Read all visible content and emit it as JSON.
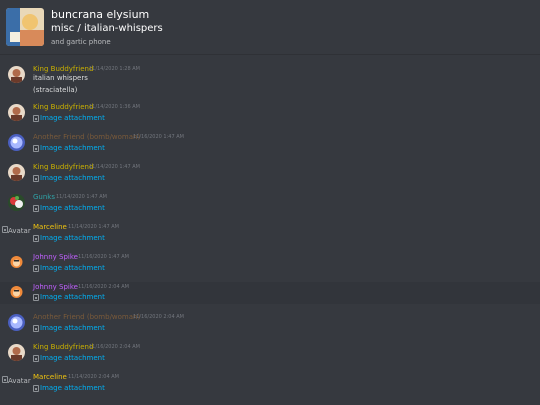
{
  "header": {
    "server_name": "buncrana elysium",
    "channel_name": "misc / italian-whispers",
    "topic": "and gartic phone"
  },
  "colors": {
    "king": "#c9b000",
    "another": "#7a5a3a",
    "gunks": "#2fa4a8",
    "marceline": "#f1c40f",
    "johnny": "#c160ff",
    "link": "#00b0f4"
  },
  "messages": [
    {
      "author": "King Buddyfriend",
      "time": "11/14/2020 1:28 AM",
      "lines": [
        "italian whispers",
        "(straciatella)"
      ]
    },
    {
      "author": "King Buddyfriend",
      "time": "11/14/2020 1:36 AM",
      "attachment": "Image attachment"
    },
    {
      "author": "Another Friend (bomb/woman)",
      "time": "11/16/2020 1:47 AM",
      "attachment": "Image attachment"
    },
    {
      "author": "King Buddyfriend",
      "time": "11/14/2020 1:47 AM",
      "attachment": "Image attachment"
    },
    {
      "author": "Gunks",
      "time": "11/14/2020 1:47 AM",
      "attachment": "Image attachment"
    },
    {
      "author": "Marceline",
      "time": "11/14/2020 1:47 AM",
      "attachment": "Image attachment",
      "avatar_alt": "Avatar"
    },
    {
      "author": "Johnny Spike",
      "time": "11/16/2020 1:47 AM",
      "attachment": "Image attachment"
    },
    {
      "author": "Johnny Spike",
      "time": "11/16/2020 2:04 AM",
      "attachment": "Image attachment"
    },
    {
      "author": "Another Friend (bomb/woman)",
      "time": "11/16/2020 2:04 AM",
      "attachment": "Image attachment"
    },
    {
      "author": "King Buddyfriend",
      "time": "11/16/2020 2:04 AM",
      "attachment": "Image attachment"
    },
    {
      "author": "Marceline",
      "time": "11/14/2020 2:04 AM",
      "attachment": "Image attachment",
      "avatar_alt": "Avatar"
    }
  ]
}
